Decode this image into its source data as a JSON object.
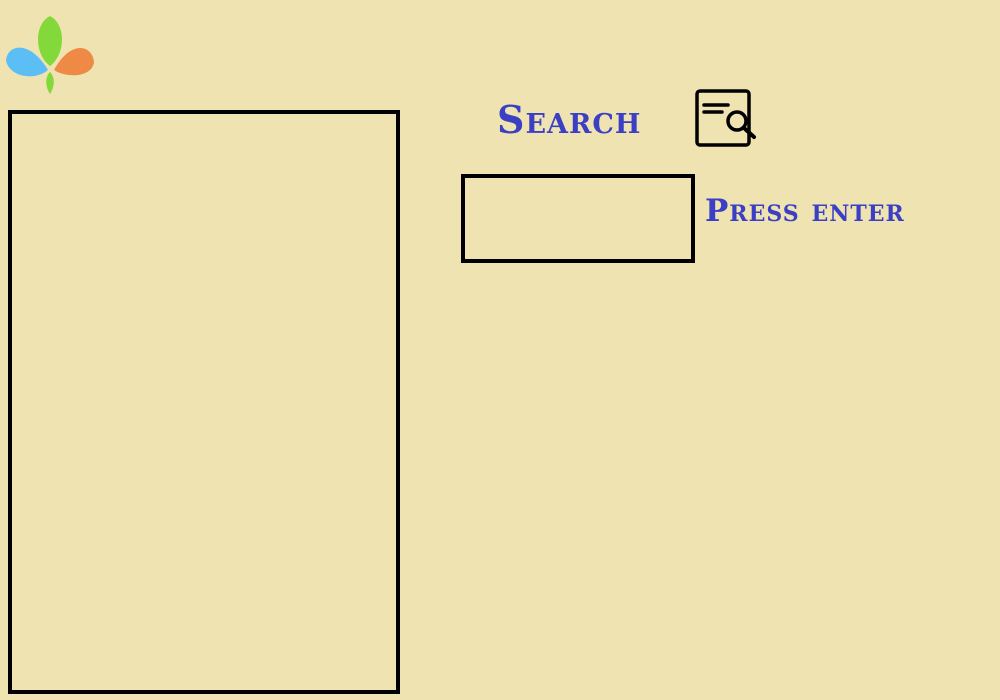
{
  "header": {
    "logo_icon": "petal-logo-icon",
    "logo_colors": {
      "blue": "#5bbff5",
      "green": "#84d93a",
      "orange": "#ee8a45"
    }
  },
  "search": {
    "title": "Search",
    "icon": "document-search-icon",
    "input_value": "",
    "hint": "Press enter"
  },
  "colors": {
    "background": "#efe3b2",
    "accent_text": "#3b3fc4",
    "border": "#000000"
  }
}
